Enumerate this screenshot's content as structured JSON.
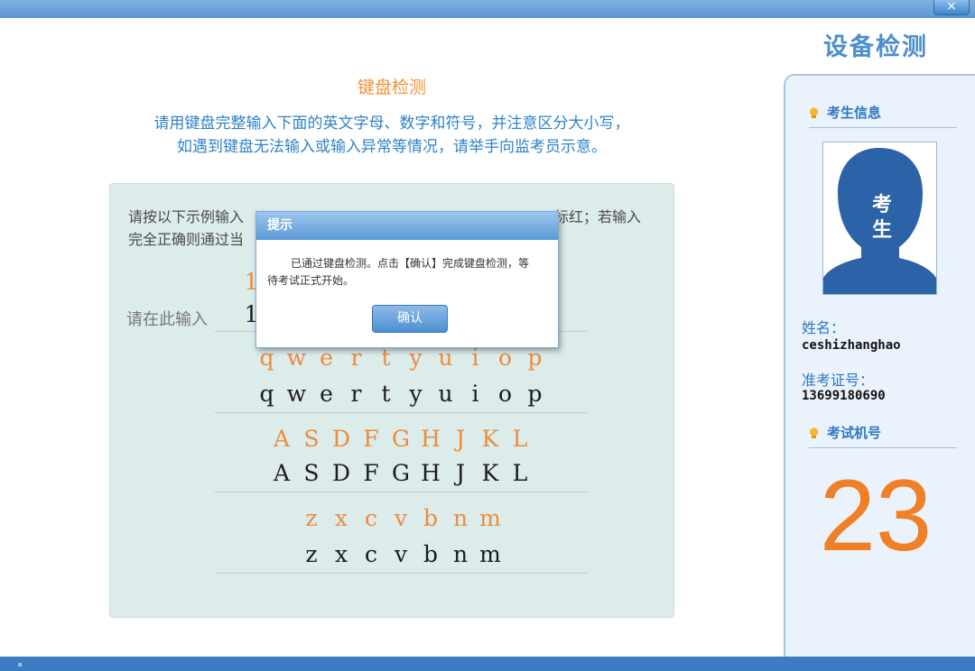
{
  "window": {
    "close_label": "×"
  },
  "main": {
    "title": "键盘检测",
    "instruction_line1": "请用键盘完整输入下面的英文字母、数字和符号，并注意区分大小写，",
    "instruction_line2": "如遇到键盘无法输入或输入异常等情况，请举手向监考员示意。",
    "tip_line1": "请按以下示例输入",
    "tip_line1_tail": "标红；若输入",
    "tip_line2": "完全正确则通过当",
    "input_label": "请在此输入",
    "rows": [
      {
        "sample": [
          "1"
        ],
        "typed": [
          "1"
        ]
      },
      {
        "sample": [
          "q",
          "w",
          "e",
          "r",
          "t",
          "y",
          "u",
          "i",
          "o",
          "p"
        ],
        "typed": [
          "q",
          "w",
          "e",
          "r",
          "t",
          "y",
          "u",
          "i",
          "o",
          "p"
        ]
      },
      {
        "sample": [
          "A",
          "S",
          "D",
          "F",
          "G",
          "H",
          "J",
          "K",
          "L"
        ],
        "typed": [
          "A",
          "S",
          "D",
          "F",
          "G",
          "H",
          "J",
          "K",
          "L"
        ]
      },
      {
        "sample": [
          "z",
          "x",
          "c",
          "v",
          "b",
          "n",
          "m"
        ],
        "typed": [
          "z",
          "x",
          "c",
          "v",
          "b",
          "n",
          "m"
        ]
      }
    ]
  },
  "dialog": {
    "title": "提示",
    "message": "已通过键盘检测。点击【确认】完成键盘检测，等待考试正式开始。",
    "confirm_label": "确认"
  },
  "sidebar": {
    "title": "设备检测",
    "student_info_label": "考生信息",
    "photo_caption_1": "考",
    "photo_caption_2": "生",
    "name_label": "姓名：",
    "name_value": "ceshizhanghao",
    "ticket_label": "准考证号：",
    "ticket_value": "13699180690",
    "machine_label": "考试机号",
    "machine_number": "23"
  },
  "colors": {
    "accent_orange": "#f07f26",
    "accent_blue": "#2f78c2",
    "panel_bg": "#dcecea"
  }
}
